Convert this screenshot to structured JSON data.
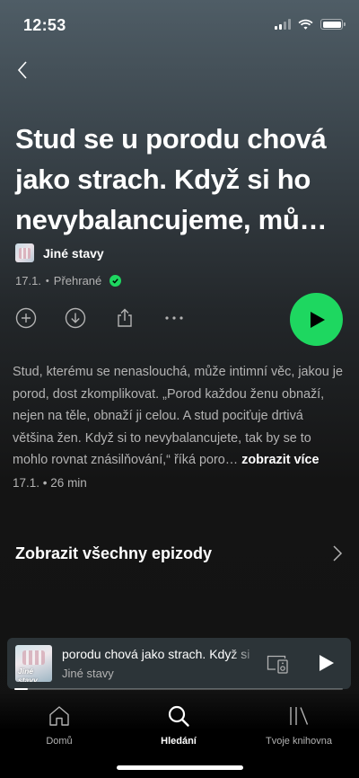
{
  "status": {
    "time": "12:53"
  },
  "episode": {
    "title": "Stud se u porodu chová jako strach. Když si ho nevybalancujeme, mů…",
    "show_name": "Jiné stavy",
    "date": "17.1.",
    "played_label": "Přehrané",
    "description": "Stud, kterému se nenaslouchá, může intimní věc, jakou je porod, dost zkomplikovat. „Porod každou ženu obnaží, nejen na těle, obnaží ji celou. A stud pociťuje drtivá většina žen. Když si to nevybalancujete, tak by se to mohlo rovnat znásilňování,“ říká poro…",
    "more_label": "zobrazit více",
    "meta_date": "17.1.",
    "meta_duration": "26 min",
    "accent_color": "#1ed760"
  },
  "all_episodes_label": "Zobrazit všechny epizody",
  "mini_player": {
    "cover_text": "Jiné stavy",
    "title": " porodu chová jako strach. Když si",
    "subtitle": "Jiné stavy",
    "progress": 0.04
  },
  "tabs": [
    {
      "label": "Domů",
      "icon": "home-icon"
    },
    {
      "label": "Hledání",
      "icon": "search-icon",
      "active": true
    },
    {
      "label": "Tvoje knihovna",
      "icon": "library-icon"
    }
  ]
}
